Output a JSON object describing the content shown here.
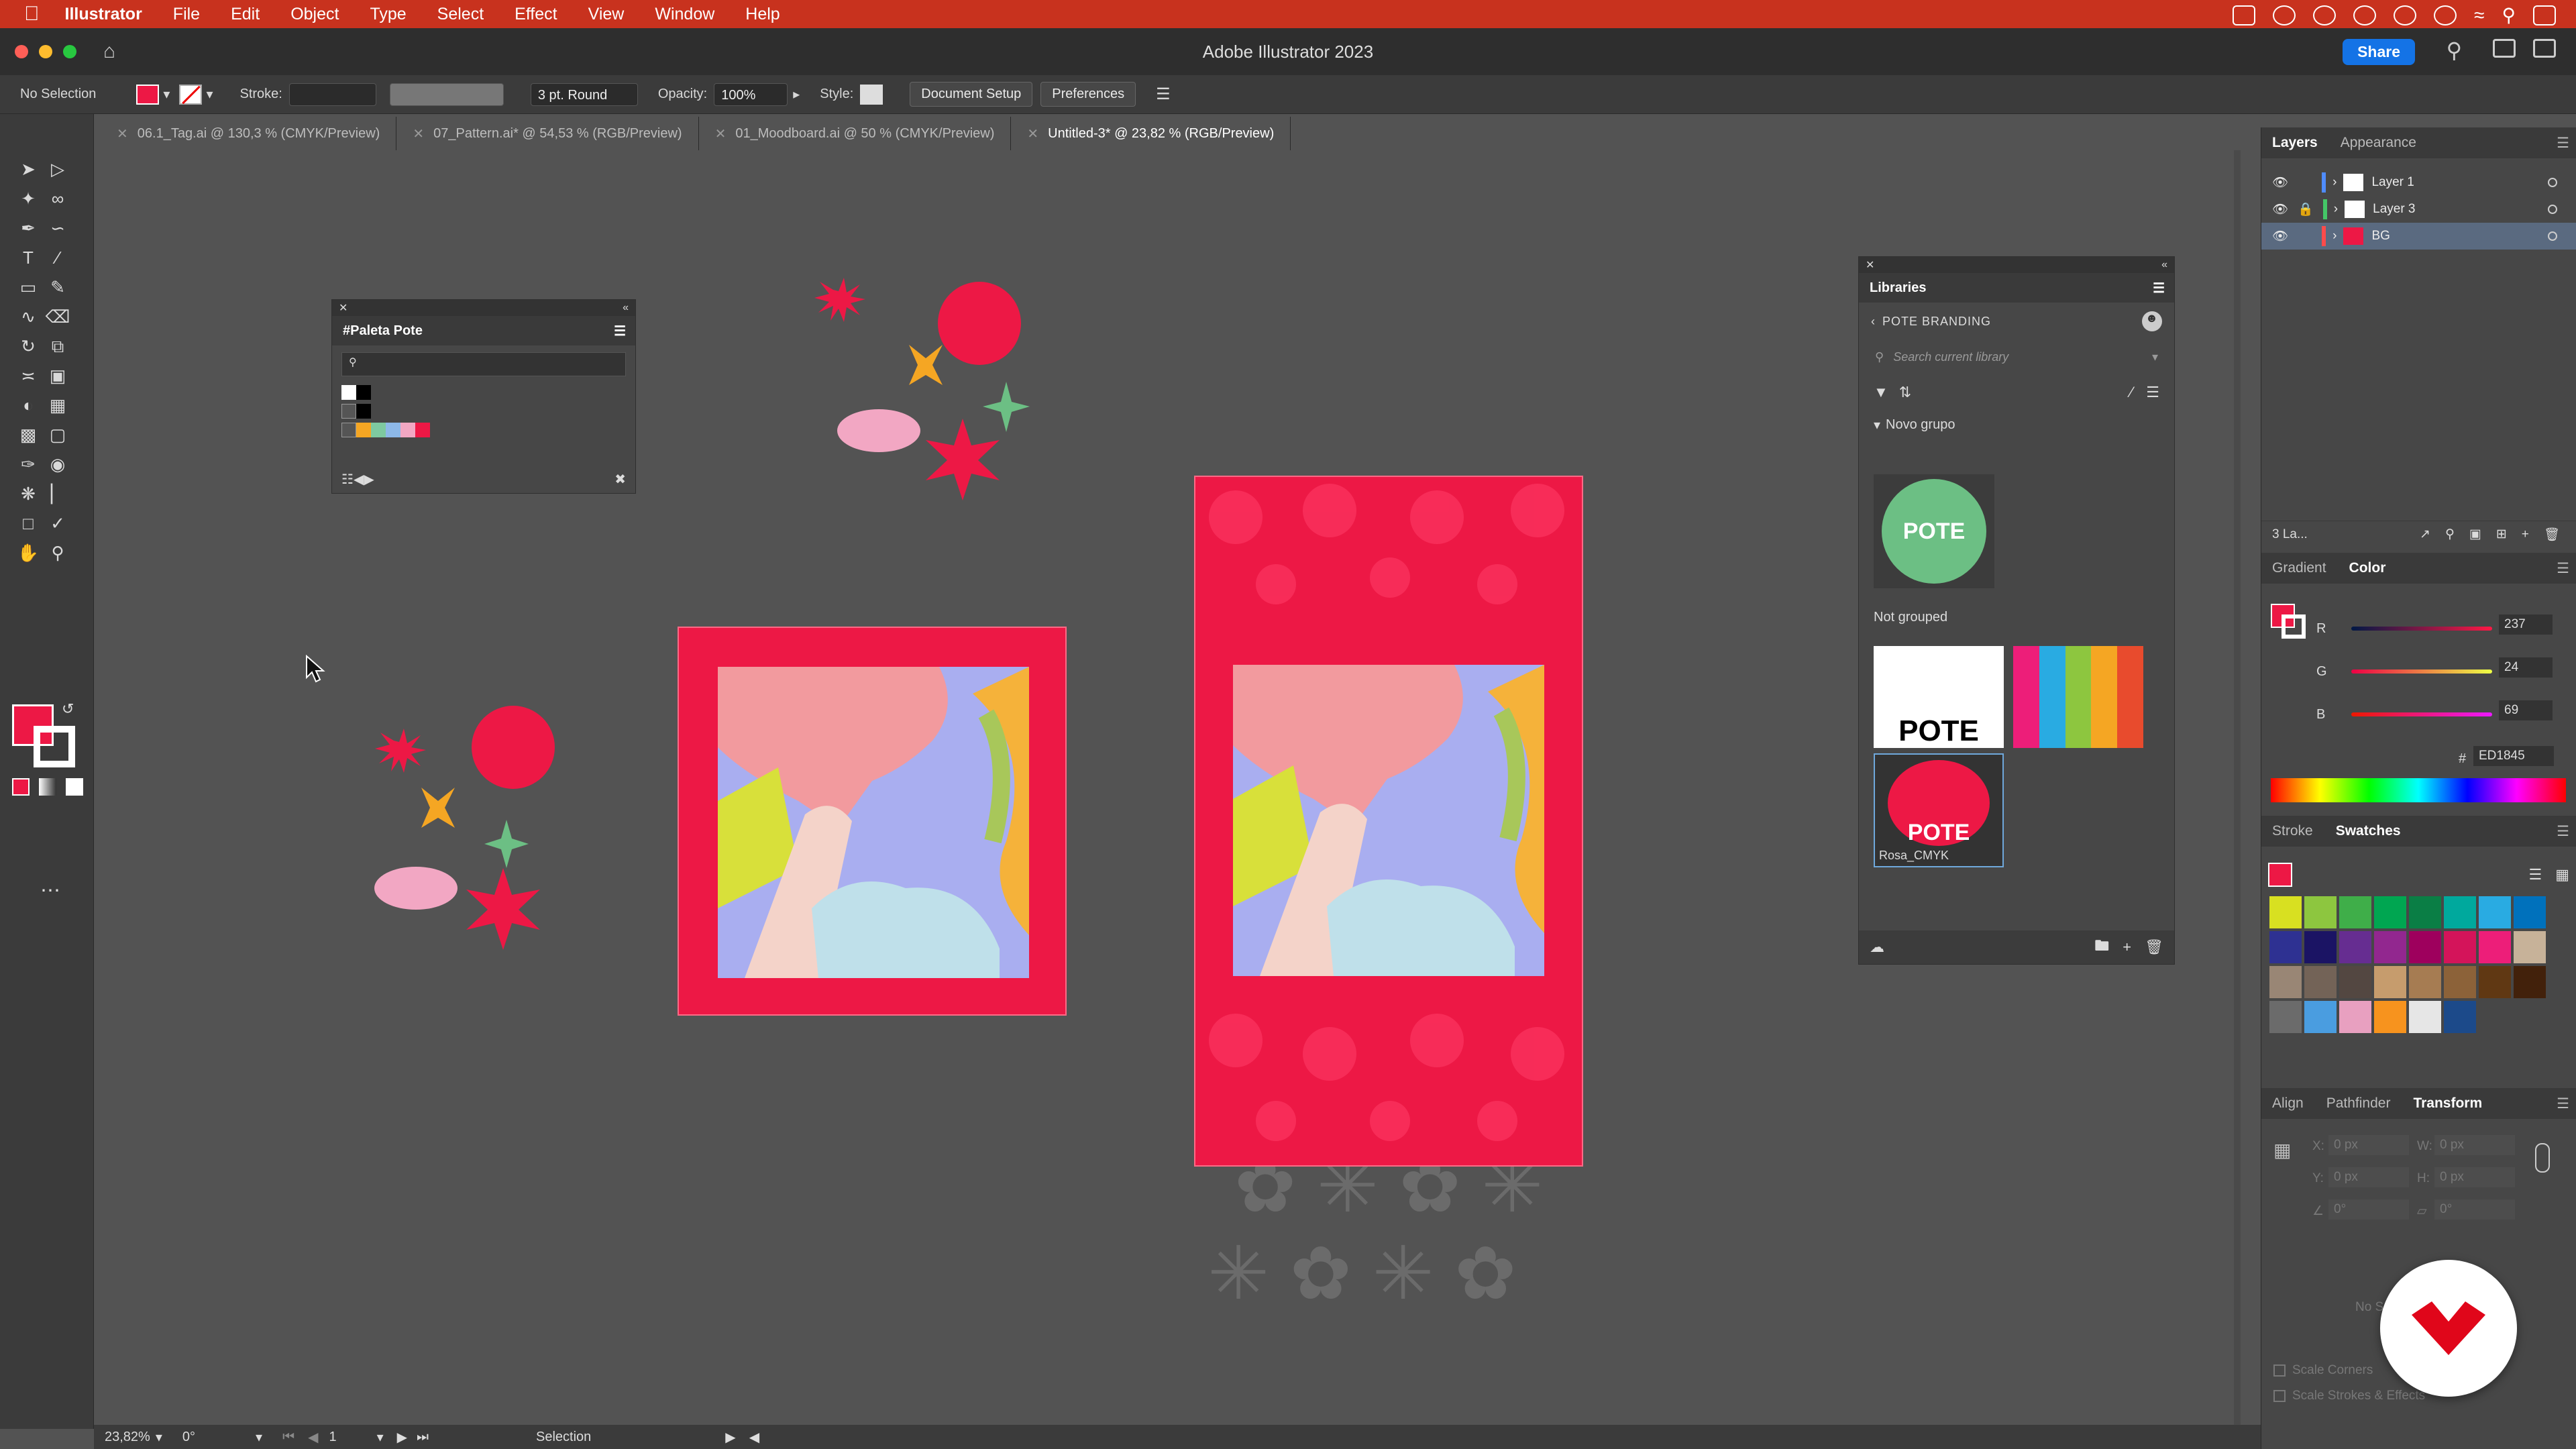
{
  "menubar": {
    "app_name": "Illustrator",
    "items": [
      "File",
      "Edit",
      "Object",
      "Type",
      "Select",
      "Effect",
      "View",
      "Window",
      "Help"
    ]
  },
  "titlebar": {
    "title": "Adobe Illustrator 2023",
    "share_label": "Share"
  },
  "control_bar": {
    "selection_status": "No Selection",
    "stroke_label": "Stroke:",
    "brush_value": "3 pt. Round",
    "opacity_label": "Opacity:",
    "opacity_value": "100%",
    "style_label": "Style:",
    "document_setup_label": "Document Setup",
    "preferences_label": "Preferences"
  },
  "tabs": [
    {
      "label": "06.1_Tag.ai @ 130,3 % (CMYK/Preview)",
      "active": false
    },
    {
      "label": "07_Pattern.ai* @ 54,53 % (RGB/Preview)",
      "active": false
    },
    {
      "label": "01_Moodboard.ai @ 50 % (CMYK/Preview)",
      "active": false
    },
    {
      "label": "Untitled-3* @ 23,82 % (RGB/Preview)",
      "active": true
    }
  ],
  "paleta_panel": {
    "title": "#Paleta Pote",
    "swatches": [
      "#f5a623",
      "#7ec9a0",
      "#8db8e8",
      "#f2a7c3",
      "#ed1845"
    ]
  },
  "libraries_panel": {
    "title": "Libraries",
    "library_name": "POTE BRANDING",
    "search_placeholder": "Search current library",
    "group_name": "Novo grupo",
    "not_grouped_label": "Not grouped",
    "logo_text": "POTE",
    "selected_item_label": "Rosa_CMYK"
  },
  "layers_panel": {
    "tabs": [
      "Layers",
      "Appearance"
    ],
    "layers": [
      {
        "name": "Layer 1",
        "color": "#4f8cff"
      },
      {
        "name": "Layer 3",
        "color": "#44c767"
      },
      {
        "name": "BG",
        "color": "#ff4b4b"
      }
    ],
    "footer_count": "3 La..."
  },
  "color_panel": {
    "tabs": [
      "Gradient",
      "Color"
    ],
    "r_label": "R",
    "r_value": "237",
    "g_label": "G",
    "g_value": "24",
    "b_label": "B",
    "b_value": "69",
    "hex_prefix": "#",
    "hex_value": "ED1845"
  },
  "swatches_panel": {
    "tabs": [
      "Stroke",
      "Swatches"
    ],
    "colors": [
      "#d8e021",
      "#8dc63f",
      "#3fae49",
      "#00a651",
      "#0a7e45",
      "#00a99d",
      "#29abe2",
      "#0071bc",
      "#2e3192",
      "#1b1464",
      "#662d91",
      "#92278f",
      "#9e005d",
      "#d4145a",
      "#ed1e79",
      "#c7b299",
      "#998675",
      "#736357",
      "#534741",
      "#c69c6d",
      "#a67c52",
      "#8c6239",
      "#603813",
      "#42210b",
      "#6b6b6b",
      "#4a9de0",
      "#e8a0c0",
      "#f7931e",
      "#e6e6e6",
      "#1c4a8a"
    ]
  },
  "transform_panel": {
    "tabs": [
      "Align",
      "Pathfinder",
      "Transform"
    ],
    "x_label": "X:",
    "x_value": "0 px",
    "y_label": "Y:",
    "y_value": "0 px",
    "w_label": "W:",
    "w_value": "0 px",
    "h_label": "H:",
    "h_value": "0 px",
    "angle_value": "0°",
    "shear_value": "0°",
    "scale_corners_label": "Scale Corners",
    "scale_strokes_label": "Scale Strokes & Effects",
    "no_selection_label": "No S"
  },
  "status_bar": {
    "zoom": "23,82%",
    "rotation": "0°",
    "artboard_number": "1",
    "tool_name": "Selection"
  },
  "colors": {
    "accent_pink": "#ed1845",
    "menubar_red": "#c8321e",
    "share_blue": "#1473e6"
  }
}
